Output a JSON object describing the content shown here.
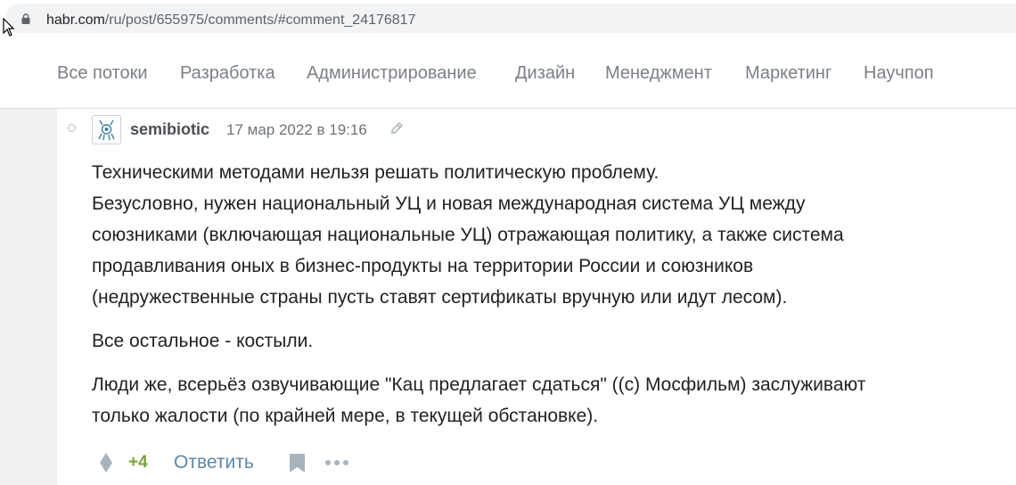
{
  "browser": {
    "url_host": "habr.com",
    "url_path": "/ru/post/655975/comments/#comment_24176817",
    "icons": {
      "lock": "lock-icon",
      "cursor": "mouse-cursor-icon"
    }
  },
  "nav": {
    "items": [
      {
        "label": "Все потоки"
      },
      {
        "label": "Разработка"
      },
      {
        "label": "Администрирование"
      },
      {
        "label": "Дизайн"
      },
      {
        "label": "Менеджмент"
      },
      {
        "label": "Маркетинг"
      },
      {
        "label": "Научпоп"
      }
    ]
  },
  "comment": {
    "author": "semibiotic",
    "date": "17 мар 2022 в 19:16",
    "paragraphs": [
      [
        "Техническими методами нельзя решать политическую проблему.",
        "Безусловно, нужен национальный УЦ и новая международная система УЦ между",
        "союзниками (включающая национальные УЦ) отражающая политику, а также система",
        "продавливания оных в бизнес-продукты на территории России и союзников",
        "(недружественные страны пусть ставят сертификаты вручную или идут лесом)."
      ],
      [
        "Все остальное - костыли."
      ],
      [
        "Люди же, всерьёз озвучивающие \"Кац предлагает сдаться\" ((с) Мосфильм) заслуживают",
        "только жалости (по крайней мере, в текущей обстановке)."
      ]
    ],
    "score": "+4",
    "reply_label": "Ответить",
    "icons": {
      "vote": "vote-diamond-icon",
      "bookmark": "bookmark-icon",
      "more": "more-dots-icon",
      "edit": "pencil-icon"
    }
  },
  "colors": {
    "score": "#7ba03f",
    "link": "#5c87a8",
    "nav_text": "#7b8087"
  }
}
